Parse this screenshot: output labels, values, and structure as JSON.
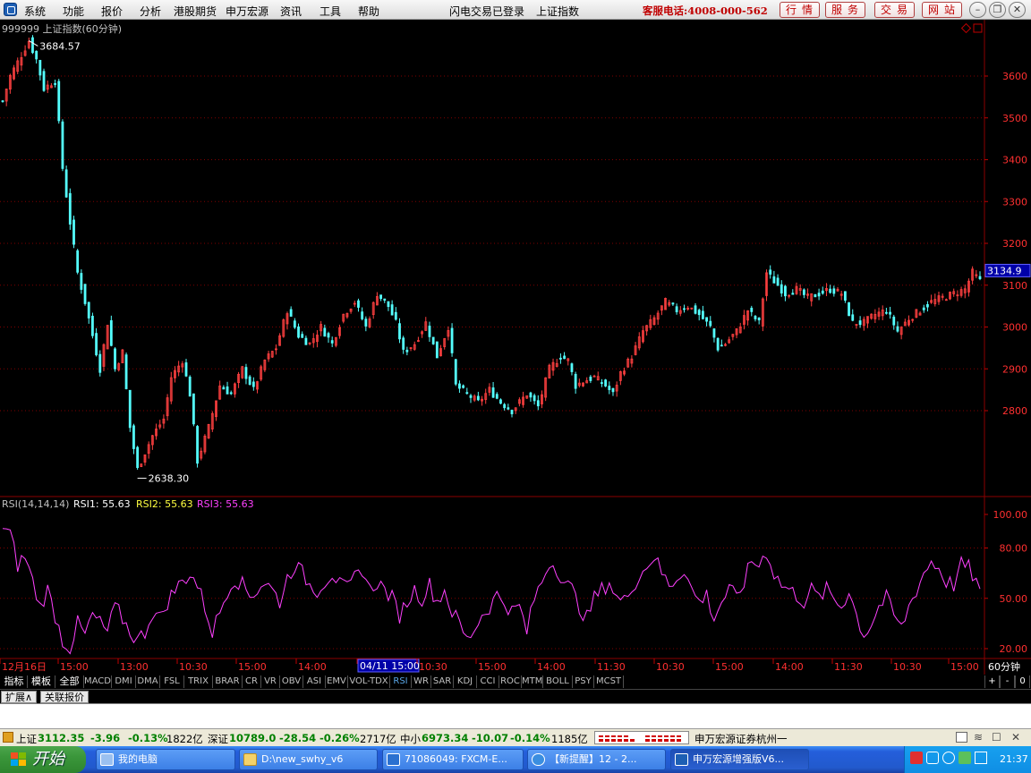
{
  "menu": {
    "items": [
      "系统",
      "功能",
      "报价",
      "分析",
      "港股期货",
      "申万宏源",
      "资讯",
      "工具",
      "帮助"
    ],
    "status": "闪电交易已登录",
    "symbol": "上证指数",
    "hotline": "客服电话:4008-000-562",
    "quick_buttons": [
      "行情",
      "服务",
      "交易",
      "网站"
    ]
  },
  "chart": {
    "title": "999999 上证指数(60分钟)",
    "last_price": "3134.9",
    "high_label": "3684.57",
    "low_label": "2638.30",
    "rsi_title": "RSI(14,14,14)",
    "rsi1_label": "RSI1: 55.63",
    "rsi2_label": "RSI2: 55.63",
    "rsi3_label": "RSI3: 55.63",
    "cursor_time": "04/11 15:00",
    "period": "60分钟"
  },
  "chart_data": [
    {
      "type": "candlestick",
      "title": "999999 上证指数(60分钟)",
      "ylim": [
        2560,
        3700
      ],
      "yticks": [
        2800,
        2900,
        3000,
        3100,
        3200,
        3300,
        3400,
        3500,
        3600
      ],
      "annotations": [
        {
          "label": "3684.57",
          "value": 3684.57
        },
        {
          "label": "2638.30",
          "value": 2638.3
        }
      ],
      "last_value": 3134.9,
      "colors": {
        "up": "#ff4040",
        "down": "#54ffff"
      },
      "keypoints": [
        [
          0,
          3540
        ],
        [
          2,
          3600
        ],
        [
          5,
          3650
        ],
        [
          7,
          3684
        ],
        [
          9,
          3640
        ],
        [
          11,
          3570
        ],
        [
          14,
          3590
        ],
        [
          16,
          3380
        ],
        [
          18,
          3250
        ],
        [
          20,
          3130
        ],
        [
          22,
          3060
        ],
        [
          24,
          2980
        ],
        [
          26,
          2900
        ],
        [
          28,
          3010
        ],
        [
          30,
          2900
        ],
        [
          32,
          2940
        ],
        [
          34,
          2760
        ],
        [
          36,
          2660
        ],
        [
          38,
          2700
        ],
        [
          40,
          2740
        ],
        [
          43,
          2780
        ],
        [
          45,
          2880
        ],
        [
          48,
          2920
        ],
        [
          50,
          2840
        ],
        [
          52,
          2680
        ],
        [
          55,
          2760
        ],
        [
          58,
          2860
        ],
        [
          61,
          2840
        ],
        [
          64,
          2900
        ],
        [
          67,
          2850
        ],
        [
          70,
          2920
        ],
        [
          73,
          2950
        ],
        [
          76,
          3040
        ],
        [
          79,
          2980
        ],
        [
          82,
          2960
        ],
        [
          85,
          3000
        ],
        [
          88,
          2960
        ],
        [
          91,
          3030
        ],
        [
          94,
          3060
        ],
        [
          97,
          3000
        ],
        [
          100,
          3080
        ],
        [
          103,
          3050
        ],
        [
          105,
          3010
        ],
        [
          107,
          2940
        ],
        [
          110,
          2960
        ],
        [
          113,
          3010
        ],
        [
          116,
          2930
        ],
        [
          119,
          3000
        ],
        [
          121,
          2860
        ],
        [
          124,
          2840
        ],
        [
          127,
          2820
        ],
        [
          130,
          2850
        ],
        [
          133,
          2820
        ],
        [
          136,
          2800
        ],
        [
          138,
          2820
        ],
        [
          140,
          2840
        ],
        [
          143,
          2810
        ],
        [
          146,
          2900
        ],
        [
          149,
          2930
        ],
        [
          151,
          2920
        ],
        [
          153,
          2860
        ],
        [
          155,
          2870
        ],
        [
          158,
          2880
        ],
        [
          161,
          2860
        ],
        [
          163,
          2840
        ],
        [
          165,
          2890
        ],
        [
          168,
          2930
        ],
        [
          171,
          2990
        ],
        [
          174,
          3020
        ],
        [
          177,
          3060
        ],
        [
          180,
          3040
        ],
        [
          183,
          3050
        ],
        [
          186,
          3030
        ],
        [
          189,
          3000
        ],
        [
          191,
          2950
        ],
        [
          193,
          2960
        ],
        [
          196,
          2990
        ],
        [
          199,
          3040
        ],
        [
          202,
          3010
        ],
        [
          204,
          3130
        ],
        [
          206,
          3110
        ],
        [
          209,
          3080
        ],
        [
          212,
          3090
        ],
        [
          215,
          3070
        ],
        [
          218,
          3080
        ],
        [
          221,
          3090
        ],
        [
          224,
          3080
        ],
        [
          227,
          3010
        ],
        [
          230,
          3010
        ],
        [
          233,
          3030
        ],
        [
          236,
          3040
        ],
        [
          239,
          2990
        ],
        [
          242,
          3020
        ],
        [
          245,
          3040
        ],
        [
          248,
          3060
        ],
        [
          251,
          3070
        ],
        [
          254,
          3080
        ],
        [
          257,
          3090
        ],
        [
          259,
          3130
        ],
        [
          261,
          3110
        ]
      ],
      "bar_count": 262
    },
    {
      "type": "line",
      "title": "RSI(14,14,14)",
      "ylim": [
        15,
        105
      ],
      "yticks": [
        20,
        50,
        80,
        100
      ],
      "series": [
        {
          "name": "RSI1",
          "color": "#ff40ff",
          "last_value": 55.63
        },
        {
          "name": "RSI2",
          "color": "#ffff40",
          "last_value": 55.63
        },
        {
          "name": "RSI3",
          "color": "#ff40ff",
          "last_value": 55.63
        }
      ],
      "rsi_keypoints": [
        [
          0,
          92
        ],
        [
          2,
          88
        ],
        [
          4,
          70
        ],
        [
          6,
          75
        ],
        [
          8,
          60
        ],
        [
          10,
          45
        ],
        [
          12,
          55
        ],
        [
          14,
          40
        ],
        [
          16,
          25
        ],
        [
          18,
          20
        ],
        [
          20,
          35
        ],
        [
          22,
          28
        ],
        [
          24,
          40
        ],
        [
          26,
          35
        ],
        [
          28,
          30
        ],
        [
          30,
          45
        ],
        [
          32,
          38
        ],
        [
          34,
          30
        ],
        [
          36,
          25
        ],
        [
          38,
          30
        ],
        [
          40,
          42
        ],
        [
          42,
          38
        ],
        [
          44,
          48
        ],
        [
          46,
          55
        ],
        [
          48,
          60
        ],
        [
          50,
          65
        ],
        [
          52,
          58
        ],
        [
          54,
          45
        ],
        [
          56,
          30
        ],
        [
          58,
          42
        ],
        [
          60,
          55
        ],
        [
          62,
          62
        ],
        [
          64,
          58
        ],
        [
          66,
          52
        ],
        [
          68,
          55
        ],
        [
          70,
          60
        ],
        [
          72,
          55
        ],
        [
          74,
          48
        ],
        [
          76,
          62
        ],
        [
          78,
          70
        ],
        [
          80,
          65
        ],
        [
          82,
          58
        ],
        [
          84,
          55
        ],
        [
          86,
          60
        ],
        [
          88,
          65
        ],
        [
          90,
          58
        ],
        [
          92,
          55
        ],
        [
          94,
          62
        ],
        [
          96,
          68
        ],
        [
          98,
          55
        ],
        [
          100,
          60
        ],
        [
          102,
          55
        ],
        [
          104,
          50
        ],
        [
          106,
          40
        ],
        [
          108,
          48
        ],
        [
          110,
          55
        ],
        [
          112,
          50
        ],
        [
          114,
          58
        ],
        [
          116,
          48
        ],
        [
          118,
          55
        ],
        [
          120,
          42
        ],
        [
          122,
          35
        ],
        [
          124,
          25
        ],
        [
          126,
          32
        ],
        [
          128,
          40
        ],
        [
          130,
          45
        ],
        [
          132,
          52
        ],
        [
          134,
          48
        ],
        [
          136,
          42
        ],
        [
          138,
          45
        ],
        [
          140,
          30
        ],
        [
          142,
          50
        ],
        [
          144,
          60
        ],
        [
          146,
          72
        ],
        [
          148,
          68
        ],
        [
          150,
          60
        ],
        [
          152,
          55
        ],
        [
          154,
          45
        ],
        [
          156,
          38
        ],
        [
          158,
          50
        ],
        [
          160,
          55
        ],
        [
          162,
          60
        ],
        [
          164,
          50
        ],
        [
          166,
          48
        ],
        [
          168,
          58
        ],
        [
          170,
          62
        ],
        [
          172,
          70
        ],
        [
          174,
          75
        ],
        [
          176,
          65
        ],
        [
          178,
          58
        ],
        [
          180,
          62
        ],
        [
          182,
          68
        ],
        [
          184,
          55
        ],
        [
          186,
          48
        ],
        [
          188,
          52
        ],
        [
          190,
          38
        ],
        [
          192,
          48
        ],
        [
          194,
          55
        ],
        [
          196,
          50
        ],
        [
          198,
          60
        ],
        [
          200,
          72
        ],
        [
          202,
          70
        ],
        [
          204,
          78
        ],
        [
          206,
          65
        ],
        [
          208,
          58
        ],
        [
          210,
          55
        ],
        [
          212,
          52
        ],
        [
          214,
          48
        ],
        [
          216,
          55
        ],
        [
          218,
          50
        ],
        [
          220,
          55
        ],
        [
          222,
          50
        ],
        [
          224,
          45
        ],
        [
          226,
          55
        ],
        [
          228,
          40
        ],
        [
          230,
          28
        ],
        [
          232,
          35
        ],
        [
          234,
          45
        ],
        [
          236,
          50
        ],
        [
          238,
          40
        ],
        [
          240,
          32
        ],
        [
          242,
          45
        ],
        [
          244,
          55
        ],
        [
          246,
          65
        ],
        [
          248,
          72
        ],
        [
          250,
          68
        ],
        [
          252,
          60
        ],
        [
          254,
          58
        ],
        [
          256,
          70
        ],
        [
          258,
          68
        ],
        [
          260,
          60
        ],
        [
          261,
          55.63
        ]
      ]
    }
  ],
  "xaxis": {
    "labels": [
      "12月16日",
      "15:00",
      "13:00",
      "10:30",
      "15:00",
      "14:00",
      "04/11 15:00",
      "10:30",
      "15:00",
      "14:00",
      "11:30",
      "10:30",
      "15:00",
      "14:00",
      "11:30",
      "10:30",
      "15:00"
    ]
  },
  "indicator_tabs": [
    "指标",
    "模板",
    "全部",
    "MACD",
    "DMI",
    "DMA",
    "FSL",
    "TRIX",
    "BRAR",
    "CR",
    "VR",
    "OBV",
    "ASI",
    "EMV",
    "VOL-TDX",
    "RSI",
    "WR",
    "SAR",
    "KDJ",
    "CCI",
    "ROC",
    "MTM",
    "BOLL",
    "PSY",
    "MCST"
  ],
  "active_tab": "RSI",
  "bottom_tabs": [
    "扩展∧",
    "关联报价"
  ],
  "page_controls": [
    "+",
    "-",
    "0"
  ],
  "ticker": {
    "sh_name": "上证",
    "sh_value": "3112.35",
    "sh_change": "-3.96",
    "sh_pct": "-0.13%",
    "sh_amount": "1822亿",
    "sz_name": "深证",
    "sz_value": "10789.0",
    "sz_change": "-28.54",
    "sz_pct": "-0.26%",
    "sz_amount": "2717亿",
    "sme_name": "中小",
    "sme_value": "6973.34",
    "sme_change": "-10.07",
    "sme_pct": "-0.14%",
    "sme_amount": "1185亿",
    "broker": "申万宏源证券杭州一"
  },
  "taskbar": {
    "start": "开始",
    "time": "21:37",
    "items": [
      "我的电脑",
      "D:\\new_swhy_v6",
      "71086049: FXCM-E...",
      "【新提醒】12 - 2...",
      "申万宏源增强版V6..."
    ]
  }
}
